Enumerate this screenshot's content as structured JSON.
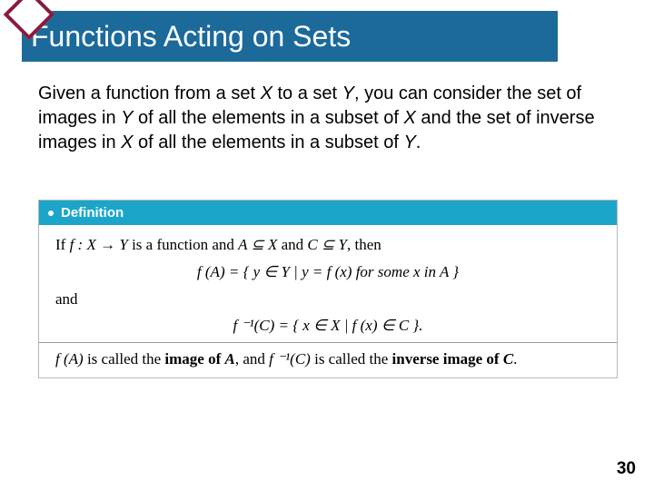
{
  "title": "Functions Acting on Sets",
  "paragraph": {
    "p1": "Given a function from a set ",
    "X1": "X",
    "p2": " to a set ",
    "Y1": "Y",
    "p3": ", you can consider the set of images in ",
    "Y2": "Y",
    "p4": " of all the elements in a subset of ",
    "X2": "X",
    "p5": " and the set of inverse images in ",
    "X3": "X",
    "p6": " of all the elements in a subset of ",
    "Y3": "Y",
    "p7": "."
  },
  "definition": {
    "header": "Definition",
    "line1a": "If ",
    "fdecl": "f : X → Y",
    "line1b": " is a function and ",
    "Asub": "A ⊆ X",
    "line1c": " and ",
    "Csub": "C ⊆ Y",
    "line1d": ", then",
    "eq1": "f (A) = { y ∈ Y | y = f (x) for some x in A }",
    "and": "and",
    "eq2": "f ⁻¹(C) = { x ∈ X | f (x) ∈ C }.",
    "line3a": "f (A)",
    "line3b": " is called the ",
    "imgA": "image of ",
    "Aletter": "A",
    "line3c": ", and ",
    "finvC": "f ⁻¹(C)",
    "line3d": " is called the ",
    "invimgC": "inverse image of ",
    "Cletter": "C",
    "line3e": "."
  },
  "page_number": "30"
}
